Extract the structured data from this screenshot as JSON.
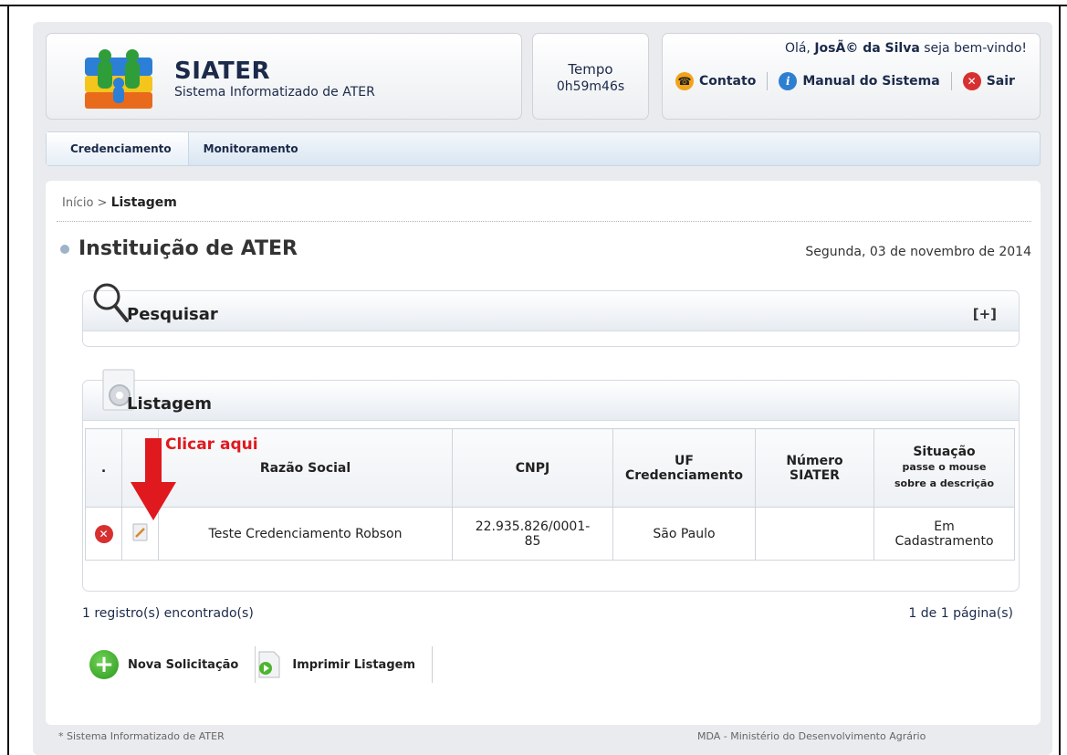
{
  "header": {
    "brand_title": "SIATER",
    "brand_subtitle": "Sistema Informatizado de ATER",
    "timer_label": "Tempo",
    "timer_value": "0h59m46s",
    "welcome_prefix": "Olá, ",
    "welcome_name": "JosÃ© da Silva",
    "welcome_suffix": " seja bem-vindo!",
    "links": {
      "contact": "Contato",
      "manual": "Manual do Sistema",
      "exit": "Sair"
    }
  },
  "nav": {
    "items": [
      "Credenciamento",
      "Monitoramento"
    ]
  },
  "breadcrumb": {
    "home": "Início",
    "separator": " > ",
    "current": "Listagem"
  },
  "page": {
    "title": "Instituição de ATER",
    "date": "Segunda, 03 de novembro de 2014"
  },
  "search_section": {
    "title": "Pesquisar",
    "toggle": "[+]"
  },
  "list_section": {
    "title": "Listagem",
    "annotation": "Clicar aqui",
    "columns": {
      "dot": ".",
      "razao_social": "Razão Social",
      "cnpj": "CNPJ",
      "uf_line1": "UF",
      "uf_line2": "Credenciamento",
      "numero_line1": "Número",
      "numero_line2": "SIATER",
      "situacao": "Situação",
      "situacao_hint1": "passe o mouse",
      "situacao_hint2": "sobre a descrição"
    },
    "rows": [
      {
        "razao_social": "Teste Credenciamento Robson",
        "cnpj_line1": "22.935.826/0001-",
        "cnpj_line2": "85",
        "uf": "São Paulo",
        "numero": "",
        "situacao_line1": "Em",
        "situacao_line2": "Cadastramento"
      }
    ],
    "count_text": "1 registro(s) encontrado(s)",
    "pages_text": "1 de 1 página(s)"
  },
  "actions": {
    "new_request": "Nova Solicitação",
    "print_list": "Imprimir Listagem"
  },
  "footer": {
    "left": "* Sistema Informatizado de ATER",
    "right": "MDA - Ministério do Desenvolvimento Agrário"
  },
  "colors": {
    "accent_red": "#e0191f",
    "nav_bg": "#d9e6f2",
    "brand_text": "#1b2a4a"
  },
  "icons": [
    "logo-icon",
    "contact-icon",
    "info-icon",
    "exit-icon",
    "search-icon",
    "gear-document-icon",
    "delete-icon",
    "edit-icon",
    "red-arrow-icon",
    "plus-icon",
    "print-icon"
  ]
}
